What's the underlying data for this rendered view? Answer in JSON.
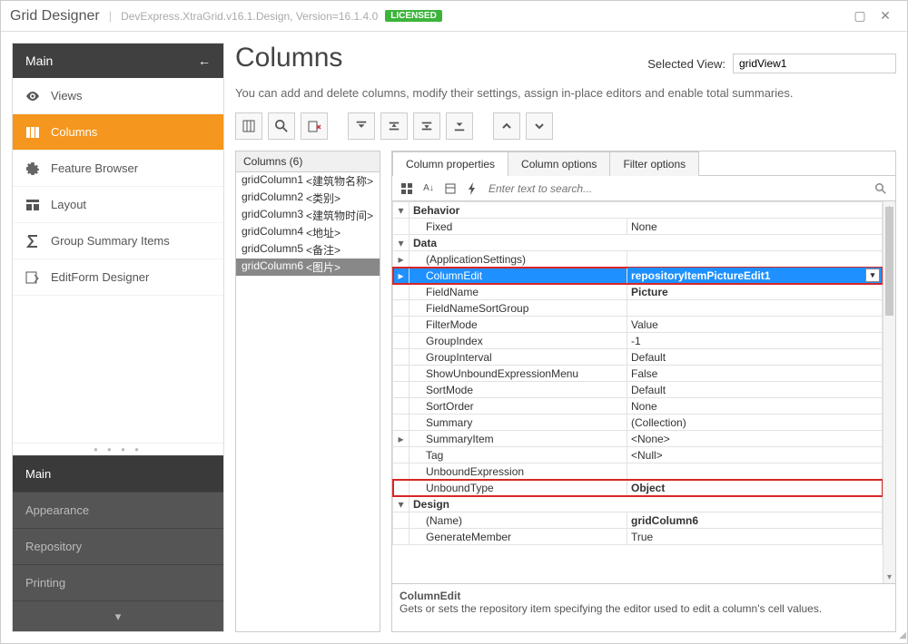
{
  "titlebar": {
    "title": "Grid Designer",
    "version": "DevExpress.XtraGrid.v16.1.Design, Version=16.1.4.0",
    "licensed": "LICENSED"
  },
  "sidebar": {
    "main": {
      "header": "Main",
      "items": [
        {
          "label": "Views"
        },
        {
          "label": "Columns"
        },
        {
          "label": "Feature Browser"
        },
        {
          "label": "Layout"
        },
        {
          "label": "Group Summary Items"
        },
        {
          "label": "EditForm Designer"
        }
      ]
    },
    "bottom": [
      {
        "label": "Main"
      },
      {
        "label": "Appearance"
      },
      {
        "label": "Repository"
      },
      {
        "label": "Printing"
      }
    ]
  },
  "page": {
    "title": "Columns",
    "selectedViewLabel": "Selected View:",
    "selectedView": "gridView1",
    "description": "You can add and delete columns, modify their settings, assign in-place editors and enable total summaries."
  },
  "columnList": {
    "header": "Columns (6)",
    "items": [
      {
        "name": "gridColumn1",
        "ext": "<建筑物名称>"
      },
      {
        "name": "gridColumn2",
        "ext": "<类别>"
      },
      {
        "name": "gridColumn3",
        "ext": "<建筑物时间>"
      },
      {
        "name": "gridColumn4",
        "ext": "<地址>"
      },
      {
        "name": "gridColumn5",
        "ext": "<备注>"
      },
      {
        "name": "gridColumn6",
        "ext": "<图片>"
      }
    ]
  },
  "tabs": {
    "items": [
      {
        "label": "Column properties"
      },
      {
        "label": "Column options"
      },
      {
        "label": "Filter options"
      }
    ]
  },
  "prop": {
    "searchPlaceholder": "Enter text to search...",
    "categories": {
      "behavior": "Behavior",
      "data": "Data",
      "design": "Design"
    },
    "rows": {
      "fixed": {
        "name": "Fixed",
        "value": "None"
      },
      "appSettings": {
        "name": "(ApplicationSettings)",
        "value": ""
      },
      "columnEdit": {
        "name": "ColumnEdit",
        "value": "repositoryItemPictureEdit1"
      },
      "fieldName": {
        "name": "FieldName",
        "value": "Picture"
      },
      "fieldNameSortGroup": {
        "name": "FieldNameSortGroup",
        "value": ""
      },
      "filterMode": {
        "name": "FilterMode",
        "value": "Value"
      },
      "groupIndex": {
        "name": "GroupIndex",
        "value": "-1"
      },
      "groupInterval": {
        "name": "GroupInterval",
        "value": "Default"
      },
      "showUnbound": {
        "name": "ShowUnboundExpressionMenu",
        "value": "False"
      },
      "sortMode": {
        "name": "SortMode",
        "value": "Default"
      },
      "sortOrder": {
        "name": "SortOrder",
        "value": "None"
      },
      "summary": {
        "name": "Summary",
        "value": "(Collection)"
      },
      "summaryItem": {
        "name": "SummaryItem",
        "value": "<None>"
      },
      "tag": {
        "name": "Tag",
        "value": "<Null>"
      },
      "unboundExpression": {
        "name": "UnboundExpression",
        "value": ""
      },
      "unboundType": {
        "name": "UnboundType",
        "value": "Object"
      },
      "nameProp": {
        "name": "(Name)",
        "value": "gridColumn6"
      },
      "generateMember": {
        "name": "GenerateMember",
        "value": "True"
      }
    },
    "desc": {
      "name": "ColumnEdit",
      "text": "Gets or sets the repository item specifying the editor used to edit a column's cell values."
    }
  }
}
